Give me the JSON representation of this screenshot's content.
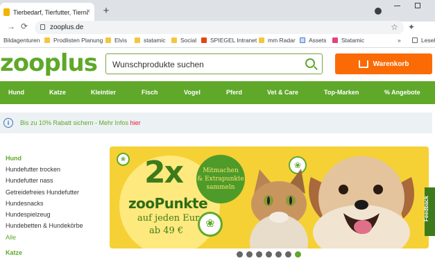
{
  "browser": {
    "tab_title": "Tierbedarf, Tierfutter, Tiernahrung",
    "tab_close": "×",
    "new_tab": "+",
    "back": "←",
    "forward": "→",
    "reload": "⟳",
    "url": "zooplus.de",
    "star": "☆",
    "extensions": "✦",
    "bookmarks": [
      "Bildagenturen",
      "Prodlisten Planung",
      "Elvis",
      "statamic",
      "Social",
      "SPIEGEL Intranet",
      "mm Radar",
      "Assets",
      "Statamic"
    ],
    "bookmarks_more": "»",
    "reading_list": "Leseli"
  },
  "site": {
    "logo": "zooplus",
    "search_placeholder": "Wunschprodukte suchen",
    "cart_label": "Warenkorb",
    "categories": [
      "Hund",
      "Katze",
      "Kleintier",
      "Fisch",
      "Vogel",
      "Pferd",
      "Vet & Care",
      "Top-Marken",
      "% Angebote"
    ],
    "info_text": "Bis zu 10% Rabatt sichern - Mehr Infos ",
    "info_link": "hier",
    "sidebar": {
      "section1": "Hund",
      "items": [
        "Hundefutter trocken",
        "Hundefutter nass",
        "Getreidefreies Hundefutter",
        "Hundesnacks",
        "Hundespielzeug",
        "Hundebetten & Hundekörbe"
      ],
      "more": "Alle",
      "section2": "Katze"
    },
    "banner": {
      "big": "2x",
      "title": "zooPunkte",
      "line1": "auf jeden Euro",
      "line2": "ab 49 €",
      "badge_line1": "Mitmachen",
      "badge_line2": "& Extrapunkte",
      "badge_line3": "sammeln"
    },
    "feedback": "Feedback",
    "carousel_active_index": 6,
    "carousel_count": 7,
    "colors": {
      "brand_green": "#5fa82a",
      "cart_orange": "#fb6b05",
      "link_red": "#e3172d"
    }
  }
}
